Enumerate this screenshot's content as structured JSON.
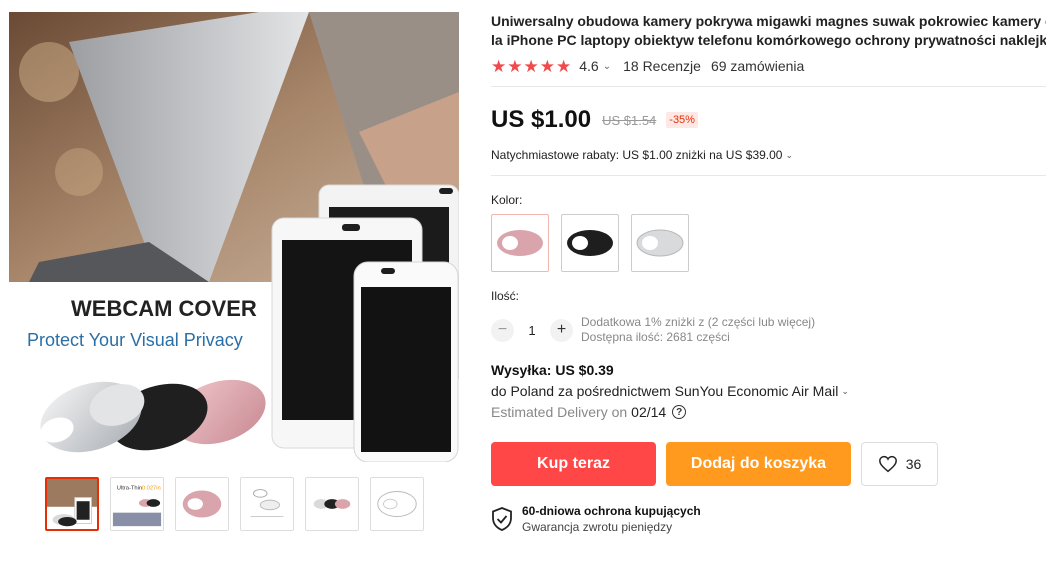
{
  "product": {
    "title_line1": "Uniwersalny obudowa kamery pokrywa migawki magnes suwak pokrowiec kamery d",
    "title_line2": "la iPhone PC laptopy obiektyw telefonu komórkowego ochrony prywatności naklejki",
    "rating": "4.6",
    "rating_stars": 5,
    "reviews": "18 Recenzje",
    "orders": "69 zamówienia"
  },
  "gallery": {
    "main_image_headline": "WEBCAM COVER",
    "main_image_tagline": "Protect Your Visual Privacy",
    "thumb2_text": "Ultra-Thin",
    "thumb2_accent": "0.027in",
    "thumbnail_count": 6
  },
  "price": {
    "current": "US $1.00",
    "original": "US $1.54",
    "discount": "-35%",
    "rebate": "Natychmiastowe rabaty: US $1.00 zniżki na US $39.00"
  },
  "options": {
    "color_label": "Kolor:",
    "colors": [
      {
        "name": "rose-gold",
        "hex": "#d9a4ab"
      },
      {
        "name": "black",
        "hex": "#1e1e1e"
      },
      {
        "name": "silver",
        "hex": "#d8dadc"
      }
    ],
    "quantity_label": "Ilość:",
    "quantity": "1",
    "bulk_note": "Dodatkowa 1% zniżki z (2 części lub więcej)",
    "stock_note": "Dostępna ilość: 2681 części"
  },
  "shipping": {
    "cost": "Wysyłka: US $0.39",
    "via": "do Poland za pośrednictwem SunYou Economic Air Mail",
    "delivery_label": "Estimated Delivery on",
    "delivery_date": "02/14"
  },
  "actions": {
    "buy_now": "Kup teraz",
    "add_to_cart": "Dodaj do koszyka",
    "wishlist_count": "36"
  },
  "protection": {
    "title": "60-dniowa ochrona kupujących",
    "subtitle": "Gwarancja zwrotu pieniędzy"
  },
  "colors": {
    "accent_red": "#ff4747",
    "accent_orange": "#ff9a1f",
    "star": "#f14a4c"
  }
}
